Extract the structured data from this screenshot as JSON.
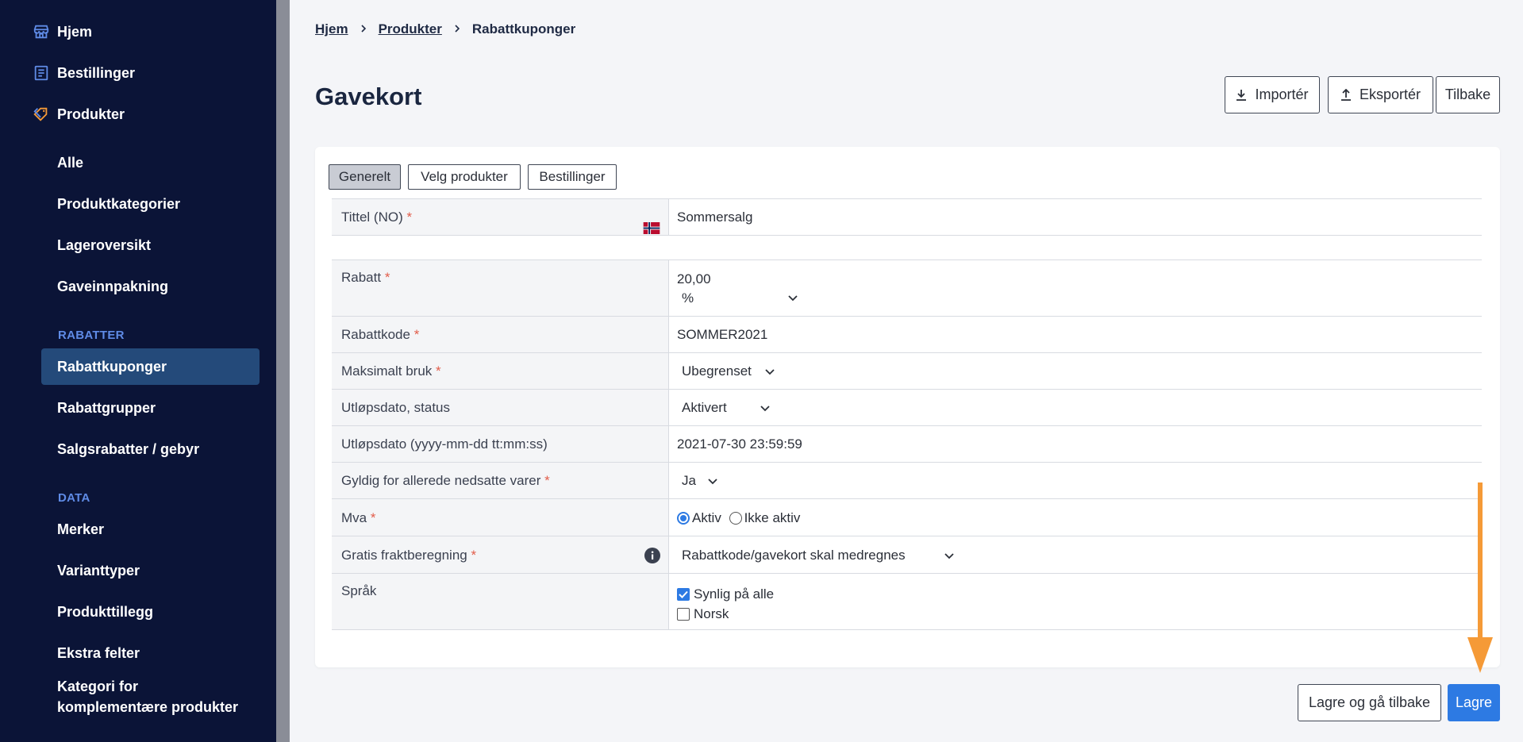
{
  "sidebar": {
    "top": [
      {
        "label": "Hjem",
        "icon": "store-icon"
      },
      {
        "label": "Bestillinger",
        "icon": "orders-icon"
      },
      {
        "label": "Produkter",
        "icon": "tag-icon"
      }
    ],
    "products_sub": [
      "Alle",
      "Produktkategorier",
      "Lageroversikt",
      "Gaveinnpakning"
    ],
    "section_rabatter": "RABATTER",
    "rabatter_items": [
      "Rabattkuponger",
      "Rabattgrupper",
      "Salgsrabatter / gebyr"
    ],
    "section_data": "DATA",
    "data_items": [
      "Merker",
      "Varianttyper",
      "Produkttillegg",
      "Ekstra felter"
    ],
    "last_item_line1": "Kategori for",
    "last_item_line2": "komplementære produkter"
  },
  "breadcrumb": {
    "home": "Hjem",
    "products": "Produkter",
    "current": "Rabattkuponger"
  },
  "page_title": "Gavekort",
  "actions": {
    "import": "Importér",
    "export": "Eksportér",
    "back": "Tilbake"
  },
  "tabs": [
    "Generelt",
    "Velg produkter",
    "Bestillinger"
  ],
  "form": {
    "title_label": "Tittel (NO)",
    "title_value": "Sommersalg",
    "discount_label": "Rabatt",
    "discount_value": "20,00",
    "discount_unit": "%",
    "code_label": "Rabattkode",
    "code_value": "SOMMER2021",
    "max_use_label": "Maksimalt bruk",
    "max_use_value": "Ubegrenset",
    "expiry_status_label": "Utløpsdato, status",
    "expiry_status_value": "Aktivert",
    "expiry_date_label": "Utløpsdato (yyyy-mm-dd tt:mm:ss)",
    "expiry_date_value": "2021-07-30 23:59:59",
    "valid_discounted_label": "Gyldig for allerede nedsatte varer",
    "valid_discounted_value": "Ja",
    "vat_label": "Mva",
    "vat_option_on": "Aktiv",
    "vat_option_off": "Ikke aktiv",
    "shipping_label": "Gratis fraktberegning",
    "shipping_value": "Rabattkode/gavekort skal medregnes",
    "language_label": "Språk",
    "language_all": "Synlig på alle",
    "language_no": "Norsk",
    "required_mark": "*"
  },
  "footer": {
    "save_back": "Lagre og gå tilbake",
    "save": "Lagre"
  },
  "colors": {
    "sidebar_bg": "#0b1437",
    "accent": "#2d7ae3",
    "arrow": "#f59a37",
    "required": "#e25d4a"
  }
}
